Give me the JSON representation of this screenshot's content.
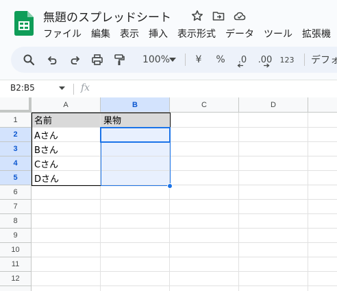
{
  "doc": {
    "title": "無題のスプレッドシート"
  },
  "menu": [
    "ファイル",
    "編集",
    "表示",
    "挿入",
    "表示形式",
    "データ",
    "ツール",
    "拡張機"
  ],
  "toolbar": {
    "zoom": "100%",
    "currency": "¥",
    "percent": "%",
    "decrease_decimal": ".0",
    "increase_decimal": ".00",
    "number_format": "123",
    "font": "デフォ"
  },
  "formula_bar": {
    "name_box": "B2:B5",
    "fx": "fx"
  },
  "grid": {
    "columns": [
      "A",
      "B",
      "C",
      "D"
    ],
    "rows": [
      "1",
      "2",
      "3",
      "4",
      "5",
      "6",
      "7",
      "8",
      "9",
      "10",
      "11",
      "12"
    ],
    "selected_columns": [
      "B"
    ],
    "selected_rows": [
      "2",
      "3",
      "4",
      "5"
    ],
    "cells": {
      "A1": "名前",
      "B1": "果物",
      "A2": "Aさん",
      "A3": "Bさん",
      "A4": "Cさん",
      "A5": "Dさん"
    },
    "header_fill_color": "#d9d9d9",
    "selection_color": "#1a73e8"
  }
}
